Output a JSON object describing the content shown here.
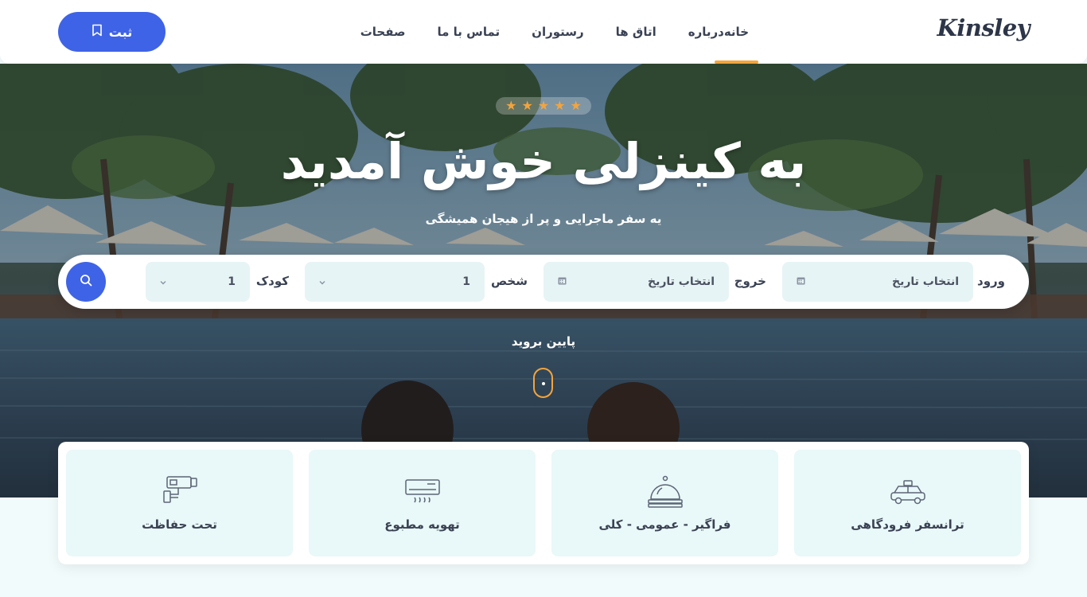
{
  "header": {
    "logo": "Kinsley",
    "nav": [
      {
        "label": "خانه",
        "active": true
      },
      {
        "label": "درباره",
        "active": false
      },
      {
        "label": "اتاق ها",
        "active": false
      },
      {
        "label": "رستوران",
        "active": false
      },
      {
        "label": "تماس با ما",
        "active": false
      },
      {
        "label": "صفحات",
        "active": false
      }
    ],
    "register_label": "ثبت",
    "register_icon": "bookmark-icon"
  },
  "hero": {
    "rating_stars": 5,
    "title": "به کینزلی خوش آمدید",
    "subtitle": "یه سفر ماجرایی و پر از هیجان همیشگی",
    "scroll_label": "پایین بروید"
  },
  "search": {
    "checkin_label": "ورود",
    "checkin_value": "انتخاب تاریخ",
    "checkout_label": "خروج",
    "checkout_value": "انتخاب تاریخ",
    "person_label": "شخص",
    "person_value": "1",
    "child_label": "کودک",
    "child_value": "1",
    "calendar_icon": "calendar-icon",
    "search_icon": "search-icon"
  },
  "features": [
    {
      "label": "ترانسفر فرودگاهی",
      "icon": "taxi-icon"
    },
    {
      "label": "فراگیر - عمومی - کلی",
      "icon": "service-bell-icon"
    },
    {
      "label": "تهویه مطبوع",
      "icon": "air-conditioner-icon"
    },
    {
      "label": "تحت حفاظت",
      "icon": "security-camera-icon"
    }
  ],
  "colors": {
    "accent": "#3f63e6",
    "highlight": "#f4a43c",
    "text": "#3a4254",
    "feature_bg": "#e9f8f8"
  }
}
